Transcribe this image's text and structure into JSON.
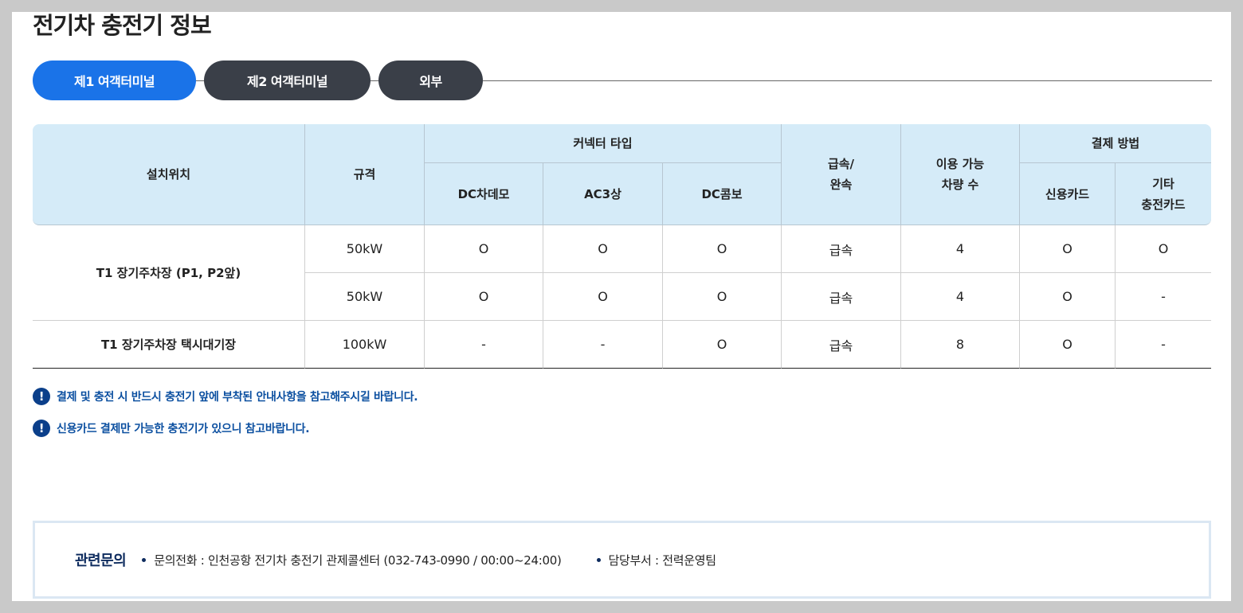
{
  "page": {
    "title": "전기차 충전기 정보"
  },
  "tabs": [
    {
      "label": "제1 여객터미널",
      "active": true
    },
    {
      "label": "제2 여객터미널",
      "active": false
    },
    {
      "label": "외부",
      "active": false
    }
  ],
  "table": {
    "headers": {
      "location": "설치위치",
      "spec": "규격",
      "connector_group": "커넥터 타입",
      "dc_chademo": "DC차데모",
      "ac3": "AC3상",
      "dc_combo": "DC콤보",
      "speed_line1": "급속/",
      "speed_line2": "완속",
      "capacity_line1": "이용 가능",
      "capacity_line2": "차량 수",
      "payment_group": "결제 방법",
      "credit_card": "신용카드",
      "other_card_line1": "기타",
      "other_card_line2": "충전카드"
    },
    "groups": [
      {
        "location": "T1 장기주차장 (P1, P2앞)",
        "rows": [
          {
            "spec": "50kW",
            "dc_chademo": "O",
            "ac3": "O",
            "dc_combo": "O",
            "speed": "급속",
            "capacity": "4",
            "credit_card": "O",
            "other_card": "O"
          },
          {
            "spec": "50kW",
            "dc_chademo": "O",
            "ac3": "O",
            "dc_combo": "O",
            "speed": "급속",
            "capacity": "4",
            "credit_card": "O",
            "other_card": "-"
          }
        ]
      },
      {
        "location": "T1 장기주차장 택시대기장",
        "rows": [
          {
            "spec": "100kW",
            "dc_chademo": "-",
            "ac3": "-",
            "dc_combo": "O",
            "speed": "급속",
            "capacity": "8",
            "credit_card": "O",
            "other_card": "-"
          }
        ]
      }
    ]
  },
  "notices": [
    "결제 및 충전 시 반드시 충전기 앞에 부착된 안내사항을 참고해주시길 바랍니다.",
    "신용카드 결제만 가능한 충전기가 있으니 참고바랍니다."
  ],
  "contact": {
    "title": "관련문의",
    "phone": "문의전화 : 인천공항 전기차 충전기 관제콜센터 (032-743-0990 / 00:00~24:00)",
    "department": "담당부서 : 전력운영팀"
  },
  "colors": {
    "active_tab": "#1a73e8",
    "inactive_tab": "#3a3f48",
    "header_bg": "#d5ebf8",
    "notice_text": "#0b4fa0",
    "contact_title": "#0d2b5e"
  }
}
